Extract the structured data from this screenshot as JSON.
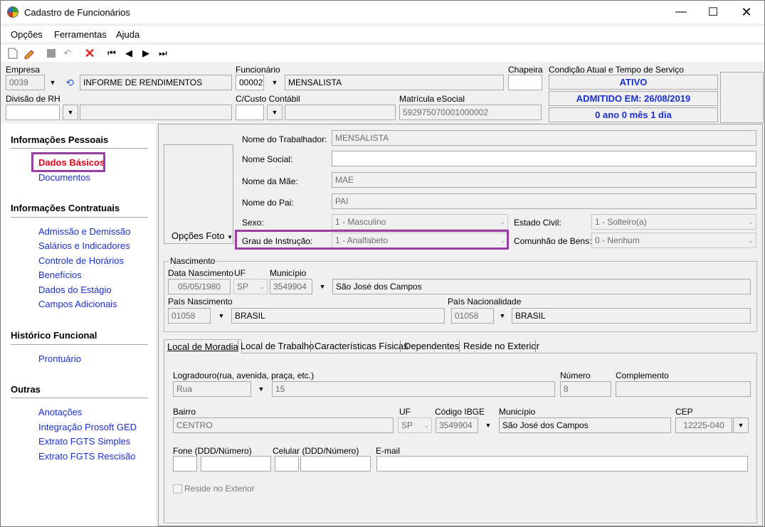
{
  "window": {
    "title": "Cadastro de Funcionários"
  },
  "menu": [
    "Opções",
    "Ferramentas",
    "Ajuda"
  ],
  "header": {
    "empresa_label": "Empresa",
    "empresa_code": "0039",
    "empresa_name": "INFORME DE RENDIMENTOS",
    "funcionario_label": "Funcionário",
    "funcionario_code": "00002",
    "funcionario_name": "MENSALISTA",
    "chapeira_label": "Chapeira",
    "chapeira_value": "",
    "divisao_label": "Divisão de RH",
    "divisao_value": "",
    "ccusto_label": "C/Custo Contábil",
    "ccusto_value": "",
    "matricula_label": "Matrícula eSocial",
    "matricula_value": "592975070001000002",
    "condicao_label": "Condição Atual e Tempo de Serviço",
    "status_ativo": "ATIVO",
    "status_admitido": "ADMITIDO EM: 26/08/2019",
    "status_tempo": "0 ano 0 mês 1 dia"
  },
  "sidebar": {
    "sections": [
      {
        "title": "Informações Pessoais",
        "items": [
          "Dados Básicos",
          "Documentos"
        ]
      },
      {
        "title": "Informações Contratuais",
        "items": [
          "Admissão e Demissão",
          "Salários e Indicadores",
          "Controle de Horários",
          "Benefícios",
          "Dados do Estágio",
          "Campos Adicionais"
        ]
      },
      {
        "title": "Histórico Funcional",
        "items": [
          "Prontuário"
        ]
      },
      {
        "title": "Outras",
        "items": [
          "Anotações",
          "Integração Prosoft GED",
          "Extrato FGTS Simples",
          "Extrato FGTS Rescisão"
        ]
      }
    ],
    "active_item": "Dados Básicos"
  },
  "basic": {
    "opcoes_foto": "Opções Foto",
    "nome_trab_label": "Nome do Trabalhador:",
    "nome_trab": "MENSALISTA",
    "nome_social_label": "Nome Social:",
    "nome_social": "",
    "nome_mae_label": "Nome da Mãe:",
    "nome_mae": "MAE",
    "nome_pai_label": "Nome do Pai:",
    "nome_pai": "PAI",
    "sexo_label": "Sexo:",
    "sexo": "1 - Masculino",
    "grau_label": "Grau de Instrução:",
    "grau": "1 - Analfabeto",
    "estado_civil_label": "Estado Civil:",
    "estado_civil": "1 - Solteiro(a)",
    "comunhao_label": "Comunhão de Bens:",
    "comunhao": "0 - Nenhum"
  },
  "nascimento": {
    "group_label": "Nascimento",
    "data_label": "Data Nascimento",
    "data": "05/05/1980",
    "uf_label": "UF",
    "uf": "SP",
    "municipio_label": "Município",
    "municipio_code": "3549904",
    "municipio_name": "São José dos Campos",
    "pais_nasc_label": "País Nascimento",
    "pais_nasc_code": "01058",
    "pais_nasc_name": "BRASIL",
    "pais_nac_label": "País Nacionalidade",
    "pais_nac_code": "01058",
    "pais_nac_name": "BRASIL"
  },
  "tabs": [
    "Local de Moradia",
    "Local de Trabalho",
    "Características Físicas",
    "Dependentes",
    "Reside no Exterior"
  ],
  "moradia": {
    "logradouro_label": "Logradouro(rua, avenida, praça, etc.)",
    "tipo_logradouro": "Rua",
    "logradouro": "15",
    "numero_label": "Número",
    "numero": "8",
    "complemento_label": "Complemento",
    "complemento": "",
    "bairro_label": "Bairro",
    "bairro": "CENTRO",
    "uf_label": "UF",
    "uf": "SP",
    "ibge_label": "Código IBGE",
    "ibge": "3549904",
    "municipio_label": "Município",
    "municipio": "São José dos Campos",
    "cep_label": "CEP",
    "cep": "12225-040",
    "fone_label": "Fone (DDD/Número)",
    "celular_label": "Celular (DDD/Número)",
    "email_label": "E-mail",
    "reside_label": "Reside no Exterior"
  }
}
